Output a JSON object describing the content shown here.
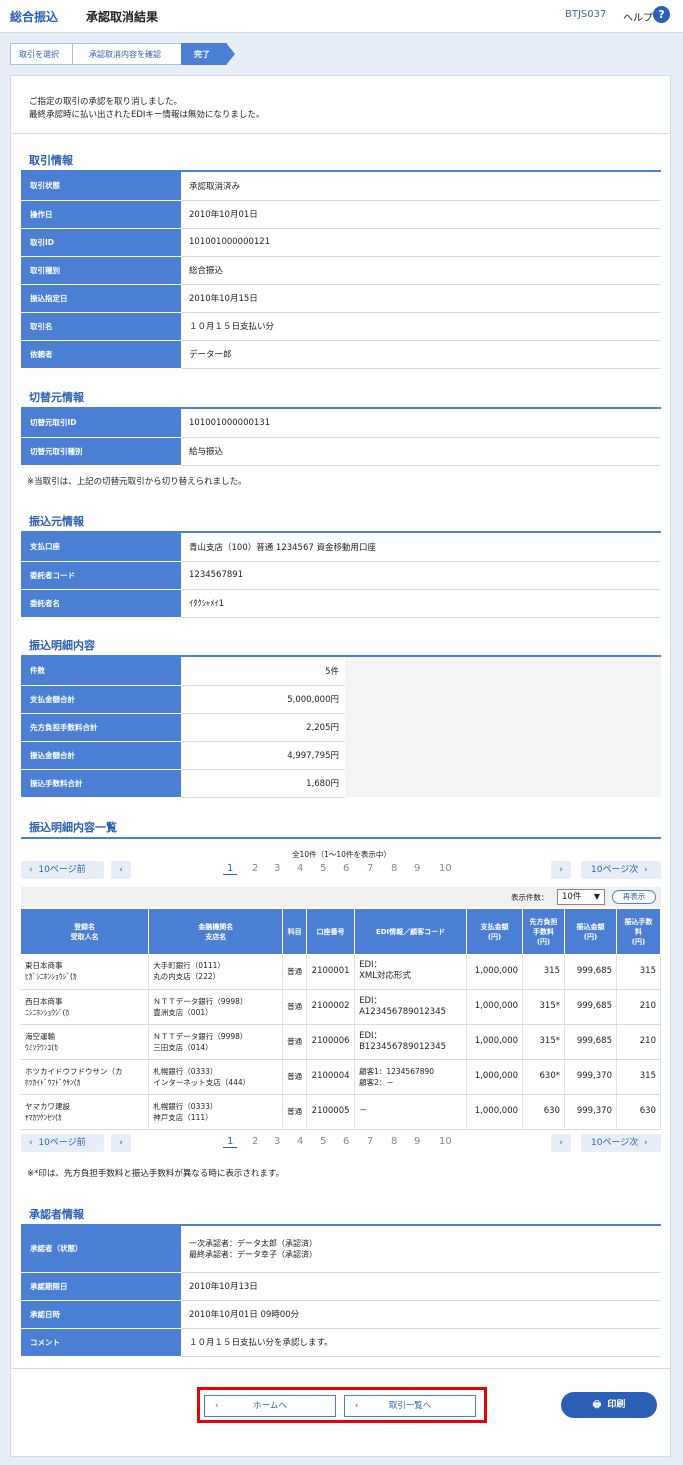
{
  "header": {
    "app": "総合振込",
    "title": "承認取消結果",
    "screen_code": "BTJS037",
    "help": "ヘルプ",
    "help_icon": "?"
  },
  "steps": [
    "取引を選択",
    "承認取消内容を確認",
    "完了"
  ],
  "message": {
    "line1": "ご指定の取引の承認を取り消しました。",
    "line2": "最終承認時に払い出されたEDIキー情報は無効になりました。"
  },
  "torihiki": {
    "title": "取引情報",
    "rows": [
      {
        "label": "取引状態",
        "value": "承認取消済み"
      },
      {
        "label": "操作日",
        "value": "2010年10月01日"
      },
      {
        "label": "取引ID",
        "value": "101001000000121"
      },
      {
        "label": "取引種別",
        "value": "総合振込"
      },
      {
        "label": "振込指定日",
        "value": "2010年10月15日"
      },
      {
        "label": "取引名",
        "value": "１０月１５日支払い分"
      },
      {
        "label": "依頼者",
        "value": "データ一郎"
      }
    ]
  },
  "kirikae": {
    "title": "切替元情報",
    "rows": [
      {
        "label": "切替元取引ID",
        "value": "101001000000131"
      },
      {
        "label": "切替元取引種別",
        "value": "給与振込"
      }
    ],
    "note": "※当取引は、上記の切替元取引から切り替えられました。"
  },
  "furikomimoto": {
    "title": "振込元情報",
    "rows": [
      {
        "label": "支払口座",
        "value": "青山支店（100）普通 1234567 資金移動用口座"
      },
      {
        "label": "委託者コード",
        "value": "1234567891"
      },
      {
        "label": "委託者名",
        "value": "ｲﾀｸｼｬﾒｲ1"
      }
    ]
  },
  "meisai": {
    "title": "振込明細内容",
    "rows": [
      {
        "label": "件数",
        "value": "5件"
      },
      {
        "label": "支払金額合計",
        "value": "5,000,000円"
      },
      {
        "label": "先方負担手数料合計",
        "value": "2,205円"
      },
      {
        "label": "振込金額合計",
        "value": "4,997,795円"
      },
      {
        "label": "振込手数料合計",
        "value": "1,680円"
      }
    ]
  },
  "list": {
    "title": "振込明細内容一覧",
    "count_text": "全10件（1～10件を表示中）",
    "prev10": "10ページ前",
    "next10": "10ページ次",
    "pages": [
      "1",
      "2",
      "3",
      "4",
      "5",
      "6",
      "7",
      "8",
      "9",
      "10"
    ],
    "display_label": "表示件数：",
    "display_value": "10件",
    "redisplay": "再表示",
    "headers": {
      "h1a": "登録名",
      "h1b": "受取人名",
      "h2a": "金融機関名",
      "h2b": "支店名",
      "h3": "科目",
      "h4": "口座番号",
      "h5": "EDI情報／顧客コード",
      "h6a": "支払金額",
      "h6b": "(円)",
      "h7a": "先方負担",
      "h7b": "手数料",
      "h7c": "(円)",
      "h8a": "振込金額",
      "h8b": "(円)",
      "h9a": "振込手数",
      "h9b": "料",
      "h9c": "(円)"
    },
    "rows": [
      {
        "name1": "東日本商事",
        "name2": "ﾋｶﾞｼﾆﾎﾝｼｮｳｼﾞ(ｶ",
        "bank1": "大手町銀行（0111）",
        "bank2": "丸の内支店（222）",
        "kamoku": "普通",
        "koza": "2100001",
        "edi1": "EDI：",
        "edi2": "XML対応形式",
        "shiharai": "1,000,000",
        "senpo": "315",
        "furikomi": "999,685",
        "tesuryo": "315"
      },
      {
        "name1": "西日本商事",
        "name2": "ﾆｼﾆﾎﾝｼｮｳｼﾞ(ｶ",
        "bank1": "ＮＴＴデータ銀行（9998）",
        "bank2": "豊洲支店（001）",
        "kamoku": "普通",
        "koza": "2100002",
        "edi1": "EDI：",
        "edi2": "A123456789012345",
        "shiharai": "1,000,000",
        "senpo": "315*",
        "furikomi": "999,685",
        "tesuryo": "210"
      },
      {
        "name1": "海空運輸",
        "name2": "ｳﾐｿﾗｳﾝﾕ(ｶ",
        "bank1": "ＮＴＴデータ銀行（9998）",
        "bank2": "三田支店（014）",
        "kamoku": "普通",
        "koza": "2100006",
        "edi1": "EDI：",
        "edi2": "B123456789012345",
        "shiharai": "1,000,000",
        "senpo": "315*",
        "furikomi": "999,685",
        "tesuryo": "210"
      },
      {
        "name1": "ホツカイドウフドウサン（カ",
        "name2": "ﾎﾂｶｲﾄﾞｳﾌﾄﾞｳｻﾝ(ｶ",
        "bank1": "札幌銀行（0333）",
        "bank2": "インターネット支店（444）",
        "kamoku": "普通",
        "koza": "2100004",
        "edi1": "顧客1：1234567890",
        "edi2": "顧客2：－",
        "shiharai": "1,000,000",
        "senpo": "630*",
        "furikomi": "999,370",
        "tesuryo": "315"
      },
      {
        "name1": "ヤマカワ建設",
        "name2": "ﾔﾏｶﾜｹﾝｾﾂ(ｶ",
        "bank1": "札幌銀行（0333）",
        "bank2": "神戸支店（111）",
        "kamoku": "普通",
        "koza": "2100005",
        "edi1": "－",
        "edi2": "",
        "shiharai": "1,000,000",
        "senpo": "630",
        "furikomi": "999,370",
        "tesuryo": "630"
      }
    ],
    "note": "※*印は、先方負担手数料と振込手数料が異なる時に表示されます。"
  },
  "shoninsha": {
    "title": "承認者情報",
    "rows": [
      {
        "label": "承認者（状態）",
        "value1": "一次承認者：データ太郎（承認済）",
        "value2": "最終承認者：データ幸子（承認済）"
      },
      {
        "label": "承認期限日",
        "value1": "2010年10月13日"
      },
      {
        "label": "承認日時",
        "value1": "2010年10月01日 09時00分"
      },
      {
        "label": "コメント",
        "value1": "１０月１５日支払い分を承認します。"
      }
    ]
  },
  "buttons": {
    "home": "ホームへ",
    "list": "取引一覧へ",
    "print": "印刷"
  },
  "colors": {
    "primary": "#2a5fb5",
    "header_cell": "#4a7fd4",
    "highlight": "#ee0000"
  }
}
